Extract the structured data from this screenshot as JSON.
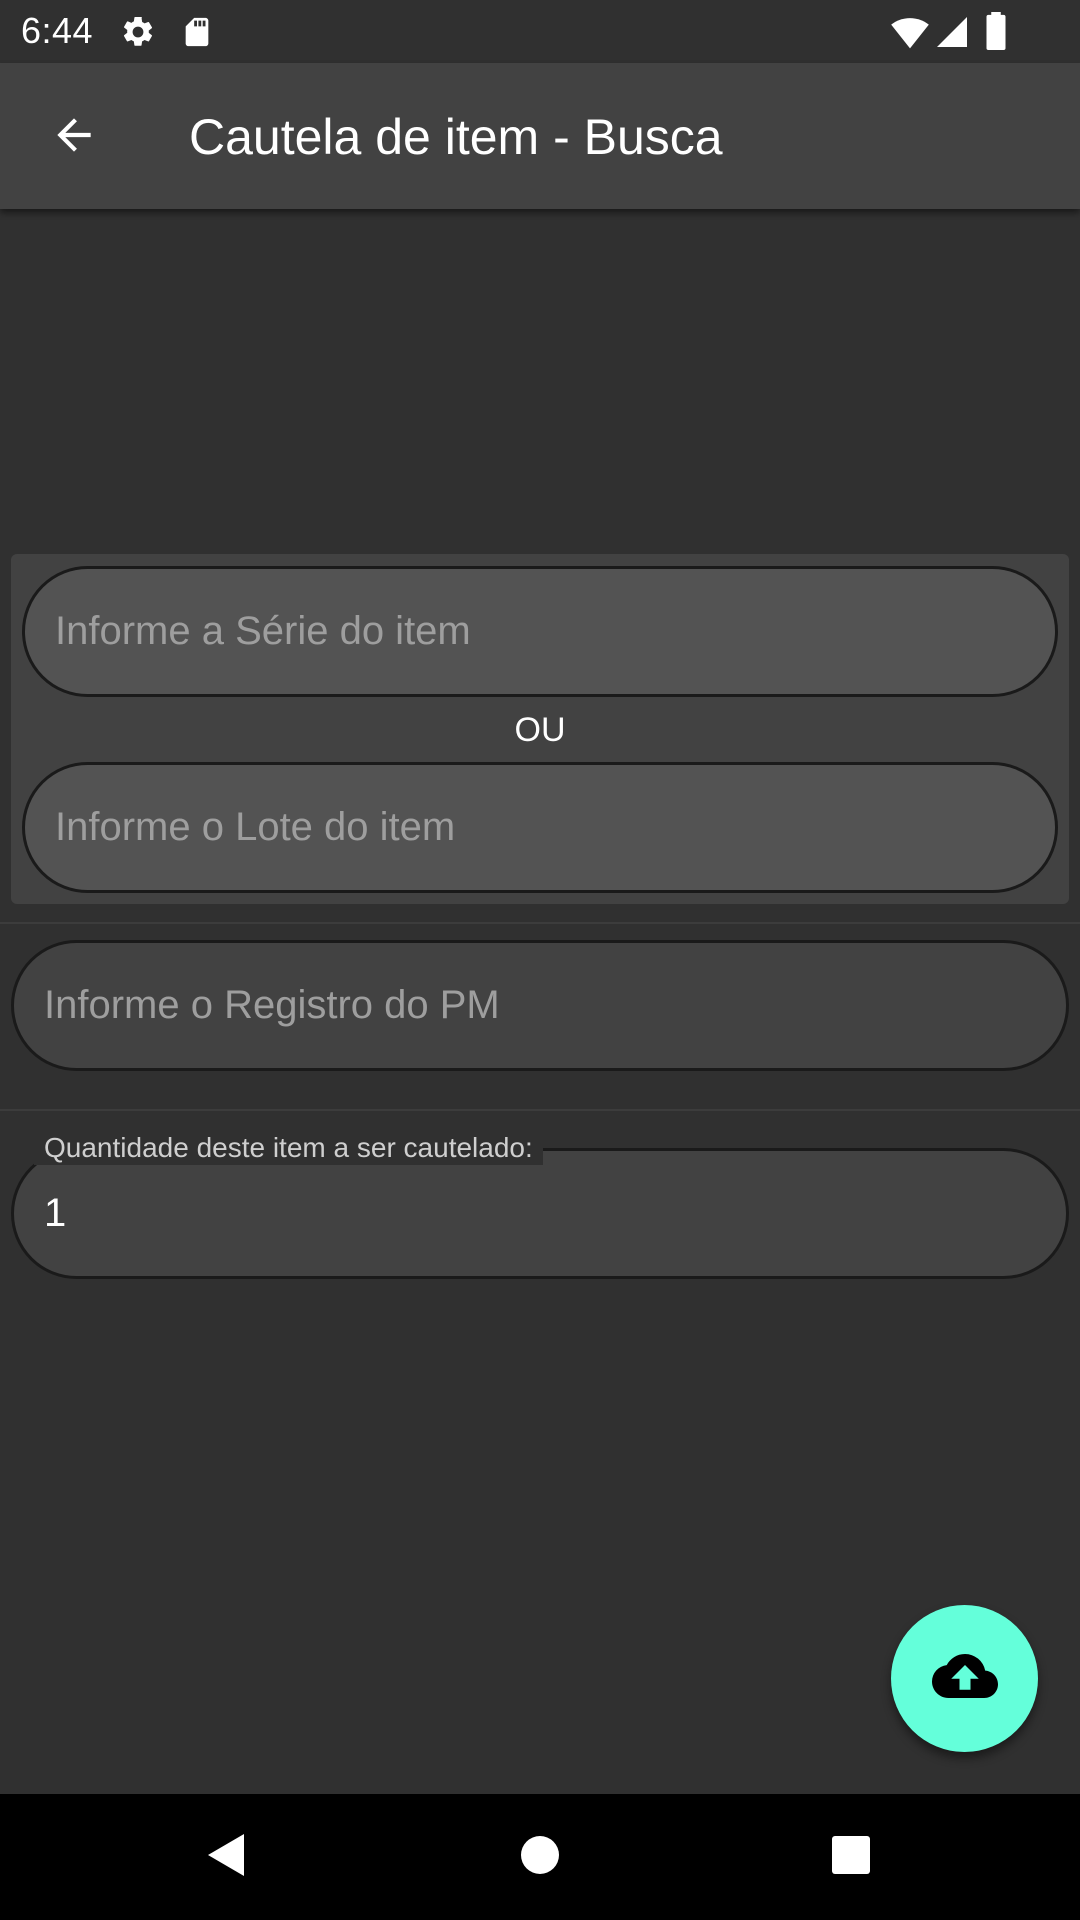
{
  "status_bar": {
    "time": "6:44",
    "icons": [
      "settings-icon",
      "sd-card-icon",
      "wifi-icon",
      "signal-icon",
      "battery-icon"
    ]
  },
  "app_bar": {
    "title": "Cautela de item - Busca",
    "back_icon": "arrow-back-icon"
  },
  "search_card": {
    "serie_placeholder": "Informe a Série do item",
    "serie_value": "",
    "separator": "OU",
    "lote_placeholder": "Informe o Lote do item",
    "lote_value": ""
  },
  "registro": {
    "placeholder": "Informe o Registro do PM",
    "value": ""
  },
  "quantidade": {
    "label": "Quantidade deste item a ser cautelado:",
    "value": "1"
  },
  "fab": {
    "icon": "cloud-upload-icon",
    "color": "#64ffda"
  },
  "nav_bar": {
    "icons": [
      "back-triangle-icon",
      "home-circle-icon",
      "recents-square-icon"
    ]
  },
  "colors": {
    "background": "#303030",
    "app_bar": "#424242",
    "accent": "#64ffda"
  }
}
